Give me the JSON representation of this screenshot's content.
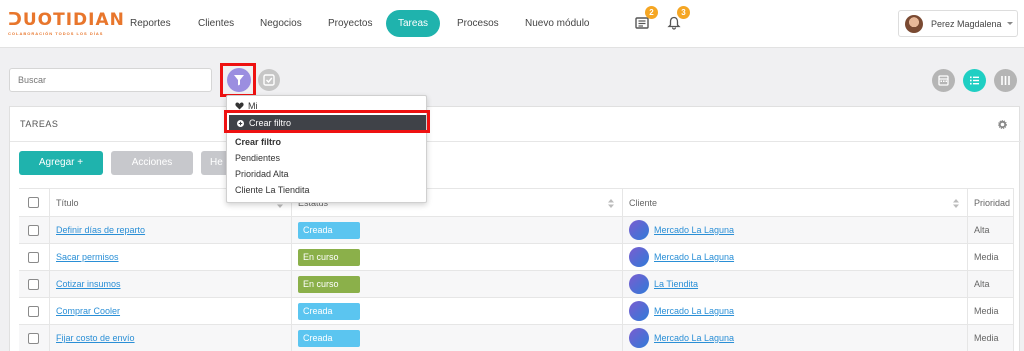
{
  "logo": {
    "word": "ᑐUOTIDIAN",
    "tagline": "COLABORACIÓN TODOS LOS DÍAS"
  },
  "nav": {
    "items": [
      {
        "label": "Reportes",
        "active": false
      },
      {
        "label": "Clientes",
        "active": false
      },
      {
        "label": "Negocios",
        "active": false
      },
      {
        "label": "Proyectos",
        "active": false
      },
      {
        "label": "Tareas",
        "active": true
      },
      {
        "label": "Procesos",
        "active": false
      },
      {
        "label": "Nuevo módulo",
        "active": false
      }
    ],
    "messages_badge": "2",
    "notifications_badge": "3"
  },
  "user": {
    "name": "Perez Magdalena"
  },
  "search": {
    "placeholder": "Buscar"
  },
  "panel": {
    "title": "TAREAS",
    "add_button": "Agregar +",
    "actions_button": "Acciones",
    "third_button": "He"
  },
  "table": {
    "columns": [
      "Título",
      "Estatus",
      "Cliente",
      "Prioridad"
    ],
    "rows": [
      {
        "title": "Definir días de reparto",
        "status": "Creada",
        "client": "Mercado La Laguna",
        "priority": "Alta"
      },
      {
        "title": "Sacar permisos",
        "status": "En curso",
        "client": "Mercado La Laguna",
        "priority": "Media"
      },
      {
        "title": "Cotizar insumos",
        "status": "En curso",
        "client": "La Tiendita",
        "priority": "Alta"
      },
      {
        "title": "Comprar Cooler",
        "status": "Creada",
        "client": "Mercado La Laguna",
        "priority": "Media"
      },
      {
        "title": "Fijar costo de envío",
        "status": "Creada",
        "client": "Mercado La Laguna",
        "priority": "Media"
      }
    ]
  },
  "filter_menu": {
    "favorite_label": "Mi",
    "create_filter_action": "Crear filtro",
    "section_header": "Crear filtro",
    "saved_filters": [
      "Pendientes",
      "Prioridad Alta",
      "Cliente La Tiendita"
    ]
  },
  "colors": {
    "accent": "#1fb3ad",
    "status_creada": "#5bc5f0",
    "status_en_curso": "#8bb04a",
    "filter_button": "#9b8ee0",
    "highlight": "#ee1111"
  }
}
